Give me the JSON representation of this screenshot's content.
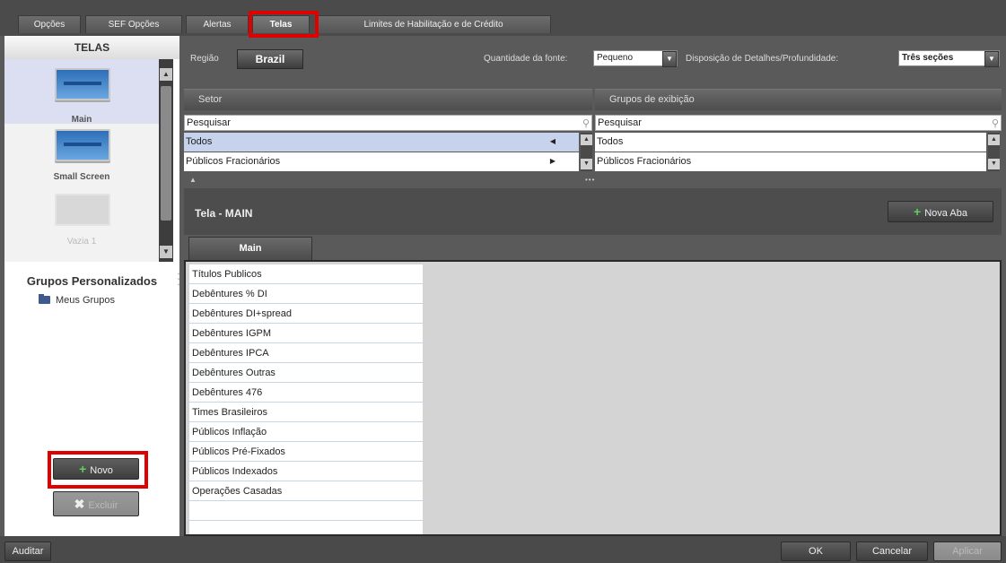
{
  "tabs": [
    {
      "label": "Opções"
    },
    {
      "label": "SEF Opções"
    },
    {
      "label": "Alertas"
    },
    {
      "label": "Telas"
    },
    {
      "label": "Limites de Habilitação e de Crédito"
    }
  ],
  "left": {
    "header": "TELAS",
    "screens": [
      {
        "label": "Main"
      },
      {
        "label": "Small Screen"
      },
      {
        "label": "Vazia 1"
      }
    ],
    "groups_title": "Grupos Personalizados",
    "my_groups": "Meus Grupos",
    "new_button": "Novo",
    "delete_button": "Excluir"
  },
  "toolbar": {
    "region_label": "Região",
    "region_value": "Brazil",
    "font_label": "Quantidade da fonte:",
    "font_value": "Pequeno",
    "layout_label": "Disposição de Detalhes/Profundidade:",
    "layout_value": "Três seções"
  },
  "sector": {
    "header": "Setor",
    "search_placeholder": "Pesquisar",
    "items": [
      "Todos",
      "Públicos Fracionários"
    ]
  },
  "display_groups": {
    "header": "Grupos de exibição",
    "search_placeholder": "Pesquisar",
    "items": [
      "Todos",
      "Públicos Fracionários"
    ]
  },
  "screen": {
    "title": "Tela - MAIN",
    "new_tab_button": "Nova Aba",
    "active_tab": "Main",
    "groups": [
      "Títulos Publicos",
      "Debêntures % DI",
      "Debêntures DI+spread",
      "Debêntures IGPM",
      "Debêntures IPCA",
      "Debêntures Outras",
      "Debêntures 476",
      "Times Brasileiros",
      "Públicos Inflação",
      "Públicos Pré-Fixados",
      "Públicos Indexados",
      "Operações Casadas"
    ]
  },
  "bottom": {
    "audit_button": "Auditar",
    "ok_button": "OK",
    "cancel_button": "Cancelar",
    "apply_button": "Aplicar"
  },
  "colors": {
    "highlight": "#e00000",
    "selection": "#c7d3ec",
    "monitor": "#2e6fb8",
    "plus": "#5fd05f"
  }
}
